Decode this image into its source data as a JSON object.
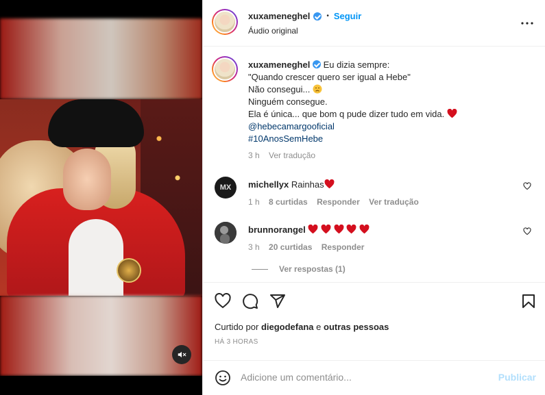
{
  "post": {
    "username": "xuxameneghel",
    "follow_label": "Seguir",
    "dot": "•",
    "audio": "Áudio original",
    "more": "..."
  },
  "caption": {
    "username": "xuxameneghel",
    "line1": "Eu dizia sempre:",
    "line2": "\"Quando crescer quero ser igual a Hebe\"",
    "line3": "Não consegui...",
    "line4": "Ninguém consegue.",
    "line5": "Ela é única... que bom q pude dizer tudo em vida.",
    "mention": "@hebecamargooficial",
    "hashtag": "#10AnosSemHebe",
    "time": "3 h",
    "translate": "Ver tradução"
  },
  "comments": [
    {
      "username": "michellyx",
      "text": "Rainhas",
      "avatar_text": "MX",
      "time": "1 h",
      "likes": "8 curtidas",
      "reply": "Responder",
      "translate": "Ver tradução",
      "hearts": 1
    },
    {
      "username": "brunnorangel",
      "text": "",
      "avatar_text": "",
      "time": "3 h",
      "likes": "20 curtidas",
      "reply": "Responder",
      "hearts": 5
    }
  ],
  "replies_label": "Ver respostas (1)",
  "likes": {
    "prefix": "Curtido por",
    "user": "diegodefana",
    "mid": "e",
    "others": "outras pessoas"
  },
  "time_ago": "HÁ 3 HORAS",
  "add_comment": {
    "placeholder": "Adicione um comentário...",
    "publish": "Publicar"
  },
  "colors": {
    "link": "#0095f6",
    "heart": "#e0245e",
    "muted": "#8e8e8e"
  },
  "icons": [
    "heart-icon",
    "comment-icon",
    "share-icon",
    "bookmark-icon",
    "mute-icon",
    "emoji-icon",
    "more-icon",
    "verified-icon"
  ]
}
